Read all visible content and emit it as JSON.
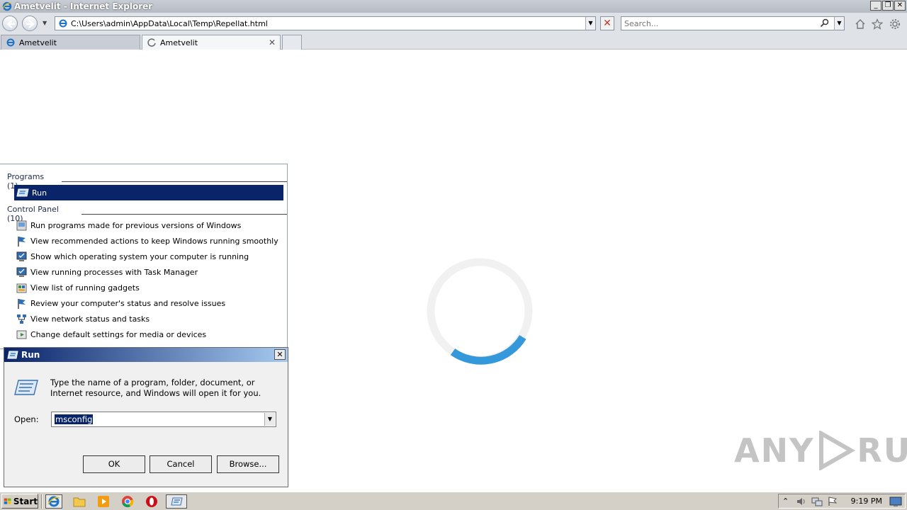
{
  "window": {
    "title": "Ametvelit - Internet Explorer"
  },
  "address_bar": {
    "url": "C:\\Users\\admin\\AppData\\Local\\Temp\\Repellat.html"
  },
  "search_box": {
    "placeholder": "Search..."
  },
  "tabs": [
    {
      "label": "Ametvelit",
      "state": "inactive"
    },
    {
      "label": "Ametvelit",
      "state": "loading"
    }
  ],
  "start_menu": {
    "programs_heading": "Programs (1)",
    "program_items": [
      {
        "label": "Run"
      }
    ],
    "control_panel_heading": "Control Panel (10)",
    "control_panel_items": [
      {
        "label": "Run programs made for previous versions of Windows",
        "icon": "compatibility-icon"
      },
      {
        "label": "View recommended actions to keep Windows running smoothly",
        "icon": "action-center-flag-icon"
      },
      {
        "label": "Show which operating system your computer is running",
        "icon": "system-icon"
      },
      {
        "label": "View running processes with Task Manager",
        "icon": "system-icon"
      },
      {
        "label": "View list of running gadgets",
        "icon": "gadgets-icon"
      },
      {
        "label": "Review your computer's status and resolve issues",
        "icon": "action-center-flag-icon"
      },
      {
        "label": "View network status and tasks",
        "icon": "network-icon"
      },
      {
        "label": "Change default settings for media or devices",
        "icon": "autoplay-icon"
      }
    ]
  },
  "run_dialog": {
    "title": "Run",
    "description": "Type the name of a program, folder, document, or Internet resource, and Windows will open it for you.",
    "open_label": "Open:",
    "open_value": "msconfig",
    "ok_label": "OK",
    "cancel_label": "Cancel",
    "browse_label": "Browse..."
  },
  "taskbar": {
    "start_label": "Start",
    "clock": "9:19 PM"
  },
  "watermark": {
    "text_left": "ANY",
    "text_right": "RUN"
  }
}
